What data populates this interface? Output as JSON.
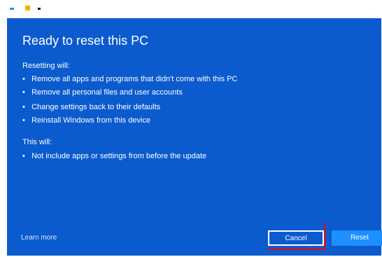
{
  "window": {
    "title_icons": [
      "dash-icon",
      "warning-icon",
      "dot-icon"
    ]
  },
  "dialog": {
    "title": "Ready to reset this PC",
    "section1_label": "Resetting will:",
    "items_section1": [
      "Remove all apps and programs that didn't come with this PC",
      "Remove all personal files and user accounts",
      "Change settings back to their defaults",
      "Reinstall Windows from this device"
    ],
    "section2_label": "This will:",
    "items_section2": [
      "Not include apps or settings from before the update"
    ],
    "learn_more": "Learn more",
    "buttons": {
      "cancel": "Cancel",
      "reset": "Reset"
    },
    "accent": "#0b5bcf",
    "primary_button_color": "#1e8fff",
    "focus_color": "#ff0000"
  }
}
